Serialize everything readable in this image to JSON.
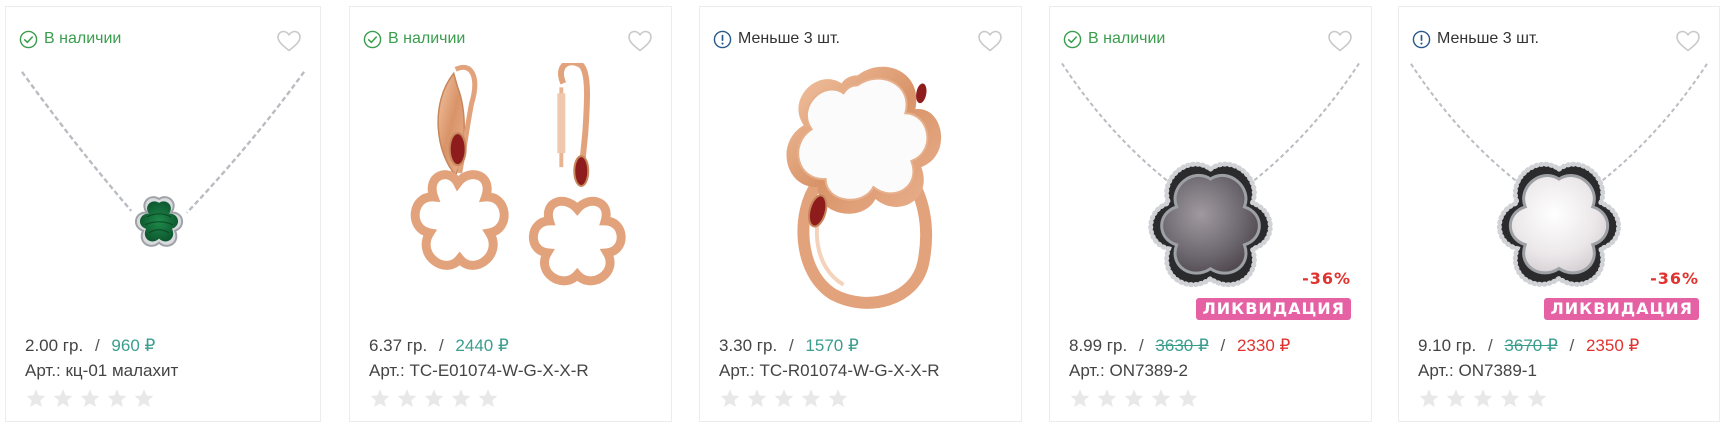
{
  "colors": {
    "in_stock": "#3a9d4e",
    "price": "#3a9d8e",
    "sale_price": "#e0332f",
    "liquidation_badge": "#e561a4",
    "star_empty": "#e8e8e8"
  },
  "products": [
    {
      "stock_status": "В наличии",
      "stock_type": "in-stock",
      "stock_icon": "check-circle-icon",
      "image": "silver-necklace-malachite-clover",
      "weight": "2.00 гр.",
      "sep": "/",
      "price": "960 ₽",
      "article": "Арт.: кц-01 малахит",
      "rating": 0,
      "max_rating": 5
    },
    {
      "stock_status": "В наличии",
      "stock_type": "in-stock",
      "stock_icon": "check-circle-icon",
      "image": "gold-clover-earrings-garnet",
      "weight": "6.37 гр.",
      "sep": "/",
      "price": "2440 ₽",
      "article": "Арт.: TC-E01074-W-G-X-X-R",
      "rating": 0,
      "max_rating": 5
    },
    {
      "stock_status": "Меньше 3 шт.",
      "stock_type": "few-left",
      "stock_icon": "exclamation-circle-icon",
      "image": "gold-clover-ring-pearl",
      "weight": "3.30 гр.",
      "sep": "/",
      "price": "1570 ₽",
      "article": "Арт.: TC-R01074-W-G-X-X-R",
      "rating": 0,
      "max_rating": 5
    },
    {
      "stock_status": "В наличии",
      "stock_type": "in-stock",
      "stock_icon": "check-circle-icon",
      "image": "silver-pendant-dark-mother-of-pearl",
      "weight": "8.99 гр.",
      "sep": "/",
      "old_price": "3630 ₽",
      "sep2": "/",
      "new_price": "2330 ₽",
      "discount": "-36%",
      "badge": "ЛИКВИДАЦИЯ",
      "article": "Арт.: ON7389-2",
      "rating": 0,
      "max_rating": 5
    },
    {
      "stock_status": "Меньше 3 шт.",
      "stock_type": "few-left",
      "stock_icon": "exclamation-circle-icon",
      "image": "silver-pendant-light-mother-of-pearl",
      "weight": "9.10 гр.",
      "sep": "/",
      "old_price": "3670 ₽",
      "sep2": "/",
      "new_price": "2350 ₽",
      "discount": "-36%",
      "badge": "ЛИКВИДАЦИЯ",
      "article": "Арт.: ON7389-1",
      "rating": 0,
      "max_rating": 5
    }
  ]
}
